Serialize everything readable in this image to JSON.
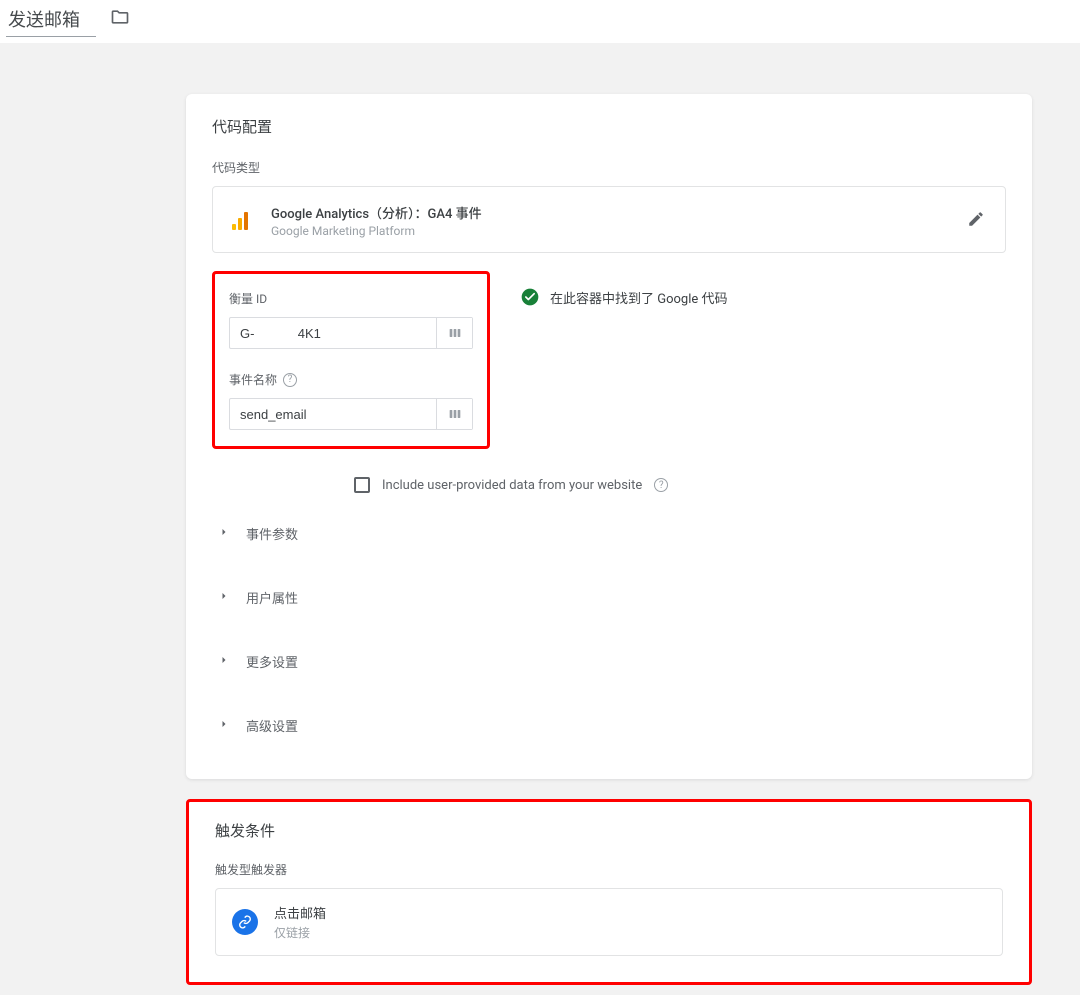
{
  "header": {
    "tag_name": "发送邮箱"
  },
  "code_config": {
    "title": "代码配置",
    "code_type_label": "代码类型",
    "tag_type": {
      "title": "Google Analytics（分析）：GA4 事件",
      "subtitle": "Google Marketing Platform"
    },
    "measurement_id": {
      "label": "衡量 ID",
      "value": "G-            4K1"
    },
    "google_tag_status": "在此容器中找到了 Google 代码",
    "event_name": {
      "label": "事件名称",
      "value": "send_email"
    },
    "include_user_data": "Include user-provided data from your website",
    "accordions": [
      "事件参数",
      "用户属性",
      "更多设置",
      "高级设置"
    ]
  },
  "triggers": {
    "title": "触发条件",
    "label": "触发型触发器",
    "row": {
      "title": "点击邮箱",
      "subtitle": "仅链接"
    }
  }
}
